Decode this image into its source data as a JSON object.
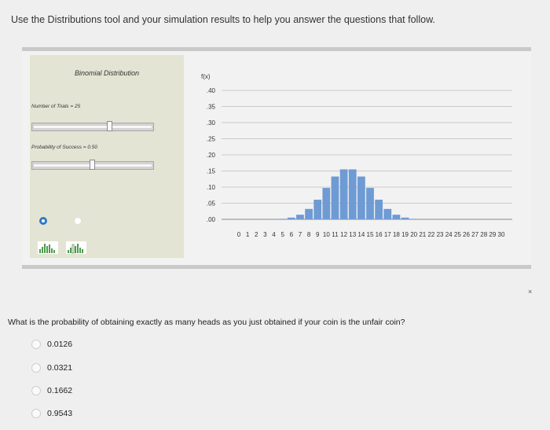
{
  "instructions": "Use the Distributions tool and your simulation results to help you answer the questions that follow.",
  "tool": {
    "panel_title": "Binomial Distribution",
    "trials_label": "Number of Trials = 25",
    "trials_slider_level": 0.65,
    "success_label": "Probability of Success = 0.50",
    "success_slider_level": 0.5,
    "radio_selected_index": 0,
    "icons": [
      "bar-chart-icon",
      "bar-chart-outline-icon"
    ],
    "close_glyph": "×"
  },
  "chart_data": {
    "type": "bar",
    "ylabel": "f(x)",
    "ylim": [
      0,
      0.4
    ],
    "yticks": [
      ".40",
      ".35",
      ".30",
      ".25",
      ".20",
      ".15",
      ".10",
      ".05",
      ".00"
    ],
    "categories": [
      "0",
      "1",
      "2",
      "3",
      "4",
      "5",
      "6",
      "7",
      "8",
      "9",
      "10",
      "11",
      "12",
      "13",
      "14",
      "15",
      "16",
      "17",
      "18",
      "19",
      "20",
      "21",
      "22",
      "23",
      "24",
      "25",
      "26",
      "27",
      "28",
      "29",
      "30"
    ],
    "values": [
      0,
      0,
      0,
      0,
      0,
      0.0016,
      0.0053,
      0.0143,
      0.0322,
      0.0609,
      0.0974,
      0.1328,
      0.155,
      0.155,
      0.1328,
      0.0974,
      0.0609,
      0.0322,
      0.0143,
      0.0053,
      0.0016,
      0,
      0,
      0,
      0,
      0,
      0,
      0,
      0,
      0,
      0
    ],
    "grid": true,
    "colors": {
      "bar": "#6e9bd4",
      "grid": "#c9c9c9"
    }
  },
  "question": {
    "text": "What is the probability of obtaining exactly as many heads as you just obtained if your coin is the unfair coin?",
    "options": [
      "0.0126",
      "0.0321",
      "0.1662",
      "0.9543"
    ]
  }
}
